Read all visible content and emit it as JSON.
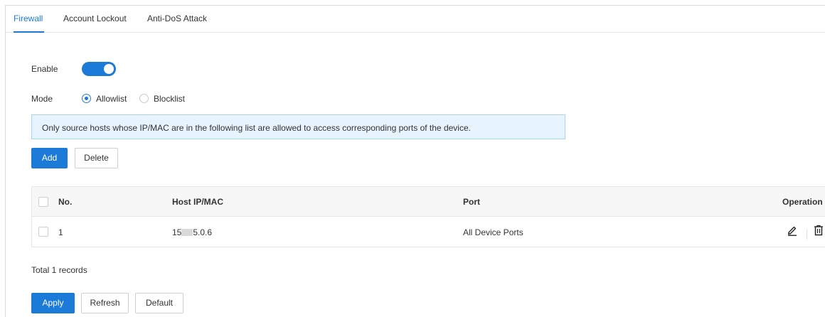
{
  "tabs": [
    {
      "label": "Firewall",
      "active": true
    },
    {
      "label": "Account Lockout",
      "active": false
    },
    {
      "label": "Anti-DoS Attack",
      "active": false
    }
  ],
  "enable": {
    "label": "Enable",
    "on": true
  },
  "mode": {
    "label": "Mode",
    "options": [
      {
        "label": "Allowlist",
        "checked": true
      },
      {
        "label": "Blocklist",
        "checked": false
      }
    ]
  },
  "info": {
    "text": "Only source hosts whose IP/MAC are in the following list are allowed to access corresponding ports of the device."
  },
  "toolbar": {
    "add_label": "Add",
    "delete_label": "Delete"
  },
  "table": {
    "headers": {
      "no": "No.",
      "host": "Host IP/MAC",
      "port": "Port",
      "operation": "Operation"
    },
    "rows": [
      {
        "no": "1",
        "host_prefix": "15",
        "host_suffix": "5.0.6",
        "port": "All Device Ports"
      }
    ]
  },
  "total": "Total 1 records",
  "footer": {
    "apply_label": "Apply",
    "refresh_label": "Refresh",
    "default_label": "Default"
  },
  "colors": {
    "accent": "#1c7bd9",
    "info_bg": "#e8f4fd",
    "info_border": "#a9d4f5"
  },
  "icons": {
    "edit": "pencil-icon",
    "delete": "trash-icon"
  }
}
